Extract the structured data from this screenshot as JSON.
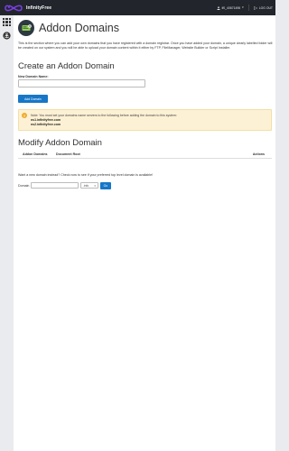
{
  "brand": {
    "name": "InfinityFree"
  },
  "topbar": {
    "user": "if0_40671496",
    "logout": "LOG OUT"
  },
  "page": {
    "title": "Addon Domains",
    "intro": "This is the section where you can add your own domains that you have registered with a domain registrar. Once you have added your domain, a unique clearly labelled folder will be created on our system and you will be able to upload your domain content within it either by FTP, FileManager, Website Builder or Script Installer.",
    "create_heading": "Create an Addon Domain",
    "new_domain_label": "New Domain Name:",
    "new_domain_value": "",
    "add_button": "Add Domain",
    "note": {
      "text": "Note: You must set your domains name servers to the following before adding the domain to this system:",
      "ns1": "ns1.infinityfree.com",
      "ns2": "ns2.infinityfree.com"
    },
    "modify_heading": "Modify Addon Domain",
    "table_headers": [
      "Addon Domains",
      "Document Root",
      "Actions"
    ],
    "want_text": "Want a new domain instead? Check now to see if your preferred top level domain is available!",
    "domain_label": "Domain",
    "domain_value": "",
    "tld_selected": ".info",
    "go_button": "Go"
  },
  "colors": {
    "topbar": "#22262c",
    "accent": "#1777c7",
    "note_bg": "#fcf1d4",
    "warn": "#f1ab2b"
  },
  "icons": {
    "logo": "infinity-logo-icon",
    "user": "user-icon",
    "logout": "logout-icon",
    "apps": "grid-icon",
    "anchor": "anchor-icon",
    "page": "addon-domain-icon",
    "warning": "warning-icon"
  }
}
